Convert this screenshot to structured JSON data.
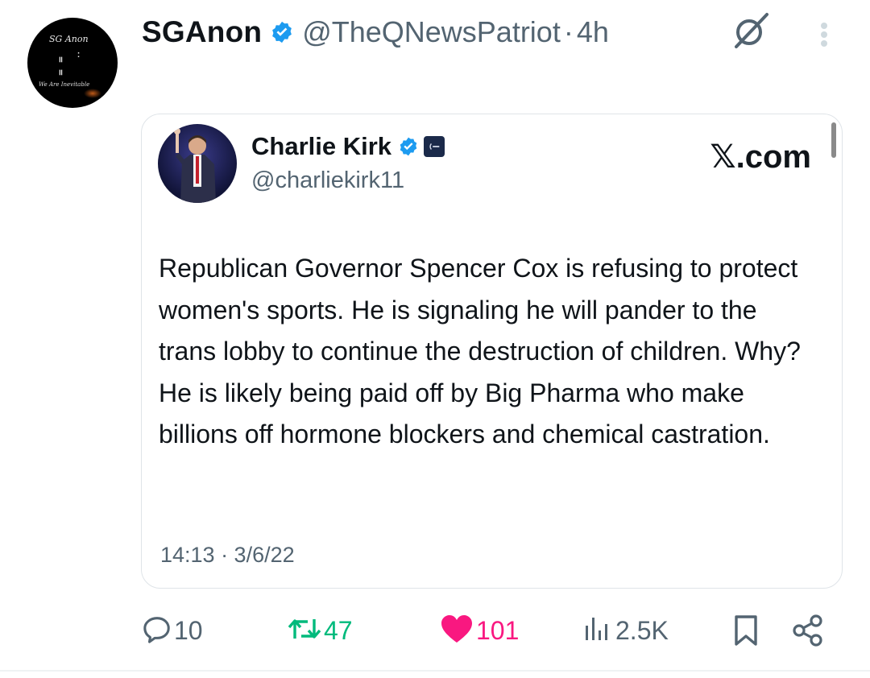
{
  "post": {
    "display_name": "SGAnon",
    "handle": "@TheQNewsPatriot",
    "separator": "·",
    "time": "4h",
    "avatar_logo_top": "SG Anon",
    "avatar_logo_bottom": "We Are Inevitable"
  },
  "quoted": {
    "name": "Charlie Kirk",
    "handle": "@charliekirk11",
    "source": "𝕏.com",
    "text": "Republican Governor Spencer Cox is refusing to protect women's sports. He is signaling he will pander to the trans lobby to continue the destruction of children. Why? He is likely being paid off by Big Pharma who make billions off hormone blockers and chemical castration.",
    "timestamp": "14:13 · 3/6/22"
  },
  "actions": {
    "replies": "10",
    "reposts": "47",
    "likes": "101",
    "views": "2.5K"
  },
  "colors": {
    "verified": "#1d9bf0",
    "repost": "#00ba7c",
    "like": "#f91880",
    "muted": "#536471"
  },
  "icons": {
    "reply": "reply-icon",
    "repost": "repost-icon",
    "like": "heart-icon",
    "views": "views-icon",
    "bookmark": "bookmark-icon",
    "share": "share-icon",
    "grok": "grok-icon",
    "more": "more-icon"
  }
}
